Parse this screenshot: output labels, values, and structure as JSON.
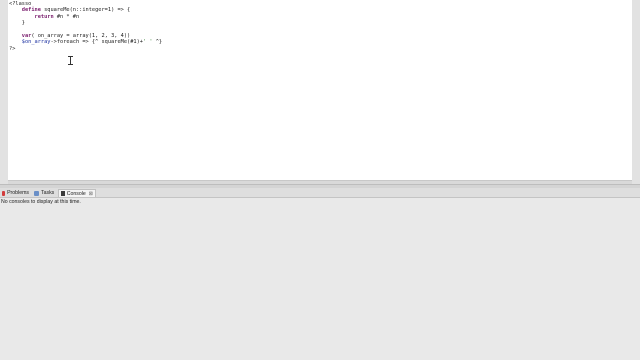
{
  "editor": {
    "lines": [
      [
        {
          "t": "<?lasso",
          "c": "plain"
        }
      ],
      [
        {
          "t": "    ",
          "c": "plain"
        },
        {
          "t": "define",
          "c": "kw"
        },
        {
          "t": " squareMe(n::integer=1) => {",
          "c": "plain"
        }
      ],
      [
        {
          "t": "        ",
          "c": "plain"
        },
        {
          "t": "return",
          "c": "kw"
        },
        {
          "t": " #n * #n",
          "c": "plain"
        }
      ],
      [
        {
          "t": "    }",
          "c": "plain"
        }
      ],
      [
        {
          "t": "",
          "c": "plain"
        }
      ],
      [
        {
          "t": "    ",
          "c": "plain"
        },
        {
          "t": "var",
          "c": "kw"
        },
        {
          "t": "( on_array = array(1, 2, 3, 4))",
          "c": "plain"
        }
      ],
      [
        {
          "t": "    ",
          "c": "plain"
        },
        {
          "t": "$on_array",
          "c": "var"
        },
        {
          "t": "->foreach => {^ squareMe(#1)+",
          "c": "plain"
        },
        {
          "t": "' '",
          "c": "str"
        },
        {
          "t": " ^}",
          "c": "plain"
        }
      ],
      [
        {
          "t": "?>",
          "c": "plain"
        }
      ]
    ]
  },
  "panel": {
    "tabs": [
      {
        "label": "Problems",
        "icon": "problems-icon"
      },
      {
        "label": "Tasks",
        "icon": "tasks-icon"
      },
      {
        "label": "Console",
        "icon": "console-icon",
        "active": true,
        "close": "⊠"
      }
    ],
    "console_message": "No consoles to display at this time."
  }
}
